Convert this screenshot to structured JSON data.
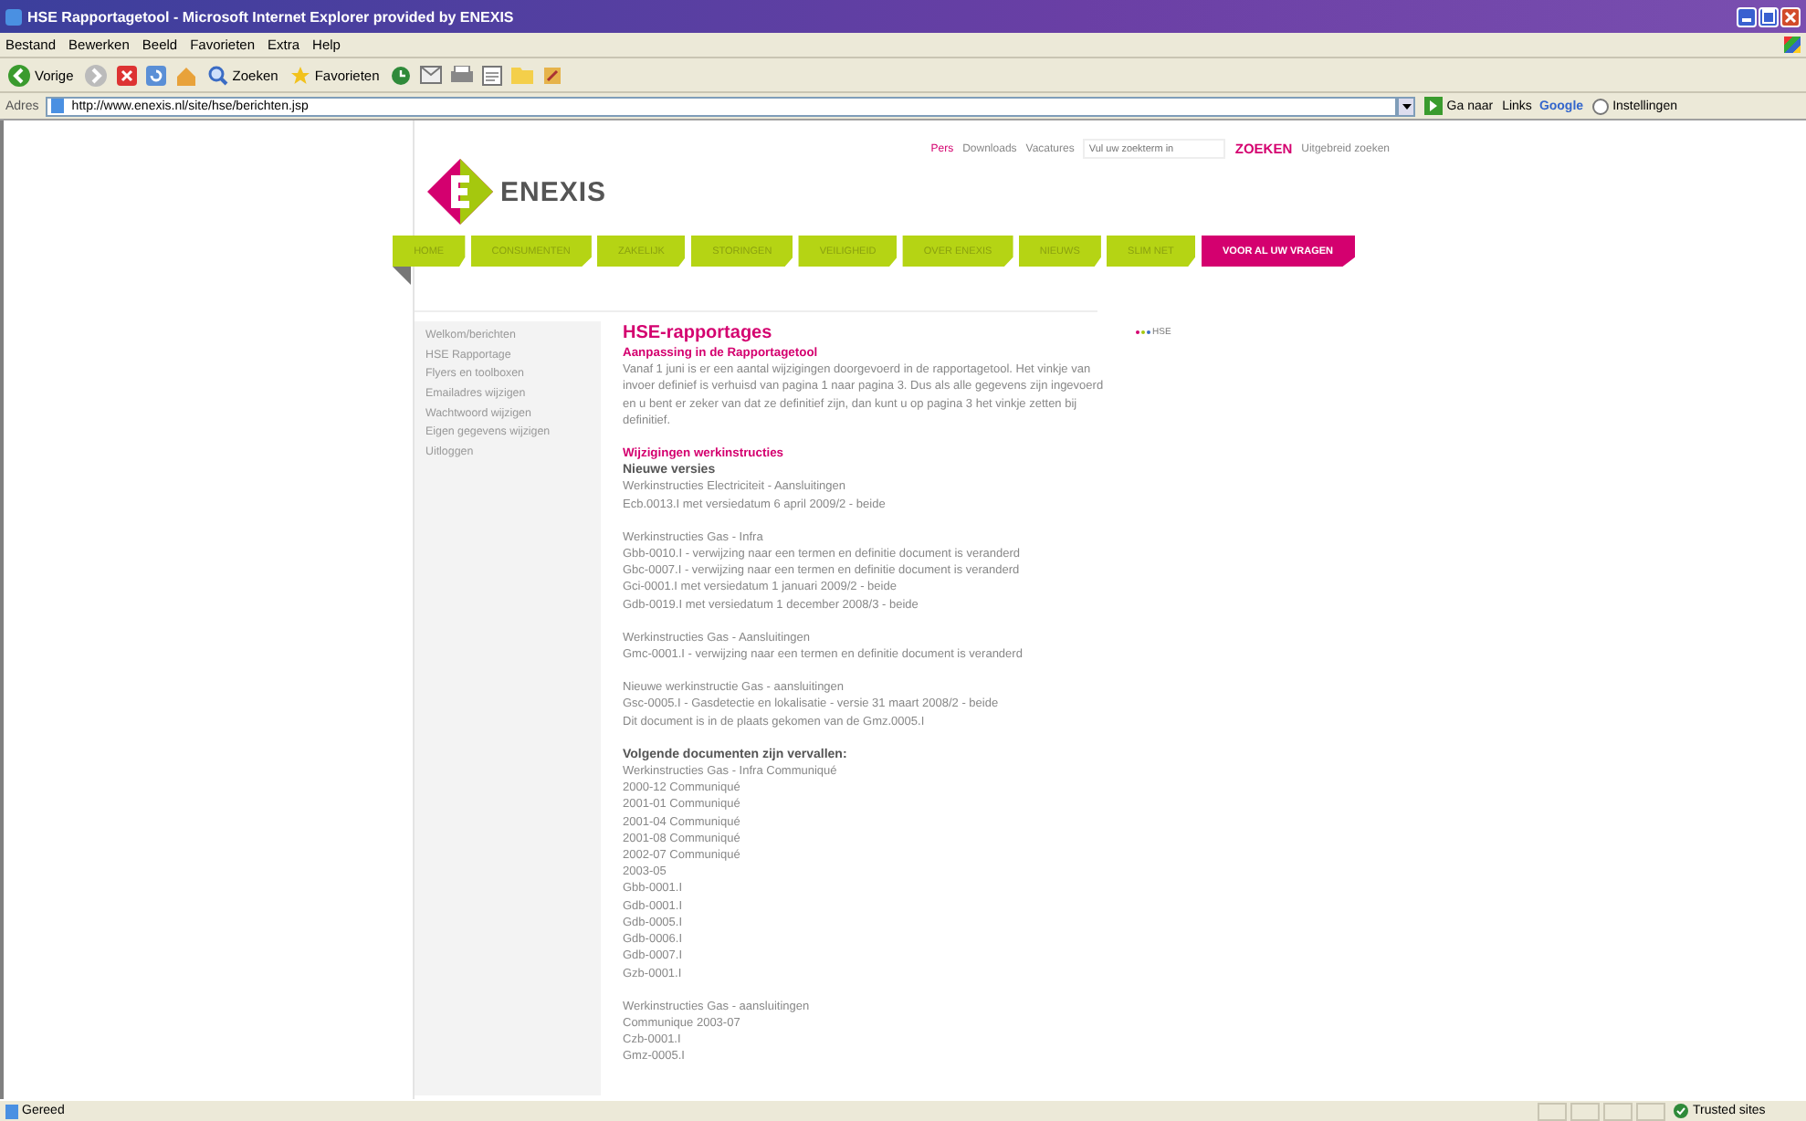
{
  "window": {
    "title": "HSE Rapportagetool - Microsoft Internet Explorer provided by ENEXIS"
  },
  "menu": [
    "Bestand",
    "Bewerken",
    "Beeld",
    "Favorieten",
    "Extra",
    "Help"
  ],
  "toolbar": {
    "back": "Vorige",
    "search": "Zoeken",
    "favorites": "Favorieten"
  },
  "address": {
    "label": "Adres",
    "url": "http://www.enexis.nl/site/hse/berichten.jsp",
    "go": "Ga naar",
    "links": "Links",
    "google": "Google",
    "settings": "Instellingen"
  },
  "header": {
    "logo": "ENEXIS",
    "top_links": [
      {
        "label": "Pers",
        "selected": true
      },
      {
        "label": "Downloads",
        "selected": false
      },
      {
        "label": "Vacatures",
        "selected": false
      }
    ],
    "search": {
      "placeholder": "Vul uw zoekterm in"
    },
    "search_button": "ZOEKEN",
    "advanced": "Uitgebreid zoeken"
  },
  "nav": [
    {
      "label": "HOME",
      "selected": false
    },
    {
      "label": "CONSUMENTEN",
      "selected": false
    },
    {
      "label": "ZAKELIJK",
      "selected": false
    },
    {
      "label": "STORINGEN",
      "selected": false
    },
    {
      "label": "VEILIGHEID",
      "selected": false
    },
    {
      "label": "OVER ENEXIS",
      "selected": false
    },
    {
      "label": "NIEUWS",
      "selected": false
    },
    {
      "label": "SLIM NET",
      "selected": false
    },
    {
      "label": "VOOR AL UW VRAGEN",
      "selected": true
    }
  ],
  "sidebar": {
    "items": [
      "Welkom/berichten",
      "HSE Rapportage",
      "Flyers en toolboxen",
      "Emailadres wijzigen",
      "Wachtwoord wijzigen",
      "Eigen gegevens wijzigen",
      "Uitloggen"
    ]
  },
  "hse_badge": "HSE",
  "content": [
    {
      "kind": "title",
      "text": "HSE-rapportages"
    },
    {
      "kind": "subtitle",
      "text": "Aanpassing in de Rapportagetool"
    },
    {
      "kind": "paragraph",
      "text": "Vanaf 1 juni is er een aantal wijzigingen doorgevoerd in de rapportagetool. Het vinkje van invoer definief is verhuisd van pagina 1 naar pagina 3. Dus als alle gegevens zijn ingevoerd en u bent er zeker van dat ze definitief zijn, dan kunt u op pagina 3 het vinkje zetten bij definitief."
    },
    {
      "kind": "subtitle",
      "text": "Wijzigingen werkinstructies"
    },
    {
      "kind": "bold",
      "text": "Nieuwe versies"
    },
    {
      "kind": "lines",
      "lines": [
        "Werkinstructies Electriciteit - Aansluitingen",
        "Ecb.0013.I met versiedatum 6 april 2009/2 - beide"
      ]
    },
    {
      "kind": "lines",
      "lines": [
        "Werkinstructies Gas - Infra",
        "Gbb-0010.I - verwijzing naar een termen en definitie document is veranderd",
        "Gbc-0007.I - verwijzing naar een termen en definitie document is veranderd",
        "Gci-0001.I met versiedatum 1 januari 2009/2 - beide",
        "Gdb-0019.I met versiedatum 1 december 2008/3 - beide"
      ]
    },
    {
      "kind": "lines",
      "lines": [
        "Werkinstructies Gas - Aansluitingen",
        "Gmc-0001.I - verwijzing naar een termen en definitie document is veranderd"
      ]
    },
    {
      "kind": "lines",
      "lines": [
        "Nieuwe werkinstructie Gas - aansluitingen",
        "Gsc-0005.I - Gasdetectie en lokalisatie - versie 31 maart 2008/2 - beide",
        "Dit document is in de plaats gekomen van de Gmz.0005.I"
      ]
    },
    {
      "kind": "bold",
      "text": "Volgende documenten zijn vervallen:"
    },
    {
      "kind": "lines",
      "lines": [
        "Werkinstructies Gas - Infra Communiqué",
        "2000-12 Communiqué",
        "2001-01 Communiqué",
        "2001-04 Communiqué",
        "2001-08 Communiqué",
        "2002-07 Communiqué",
        "2003-05",
        "Gbb-0001.I",
        "Gdb-0001.I",
        "Gdb-0005.I",
        "Gdb-0006.I",
        "Gdb-0007.I",
        "Gzb-0001.I"
      ]
    },
    {
      "kind": "lines",
      "lines": [
        "Werkinstructies Gas - aansluitingen",
        "Communique 2003-07",
        "Czb-0001.I",
        "Gmz-0005.I"
      ]
    }
  ],
  "status": {
    "text": "Gereed",
    "zone": "Trusted sites"
  }
}
